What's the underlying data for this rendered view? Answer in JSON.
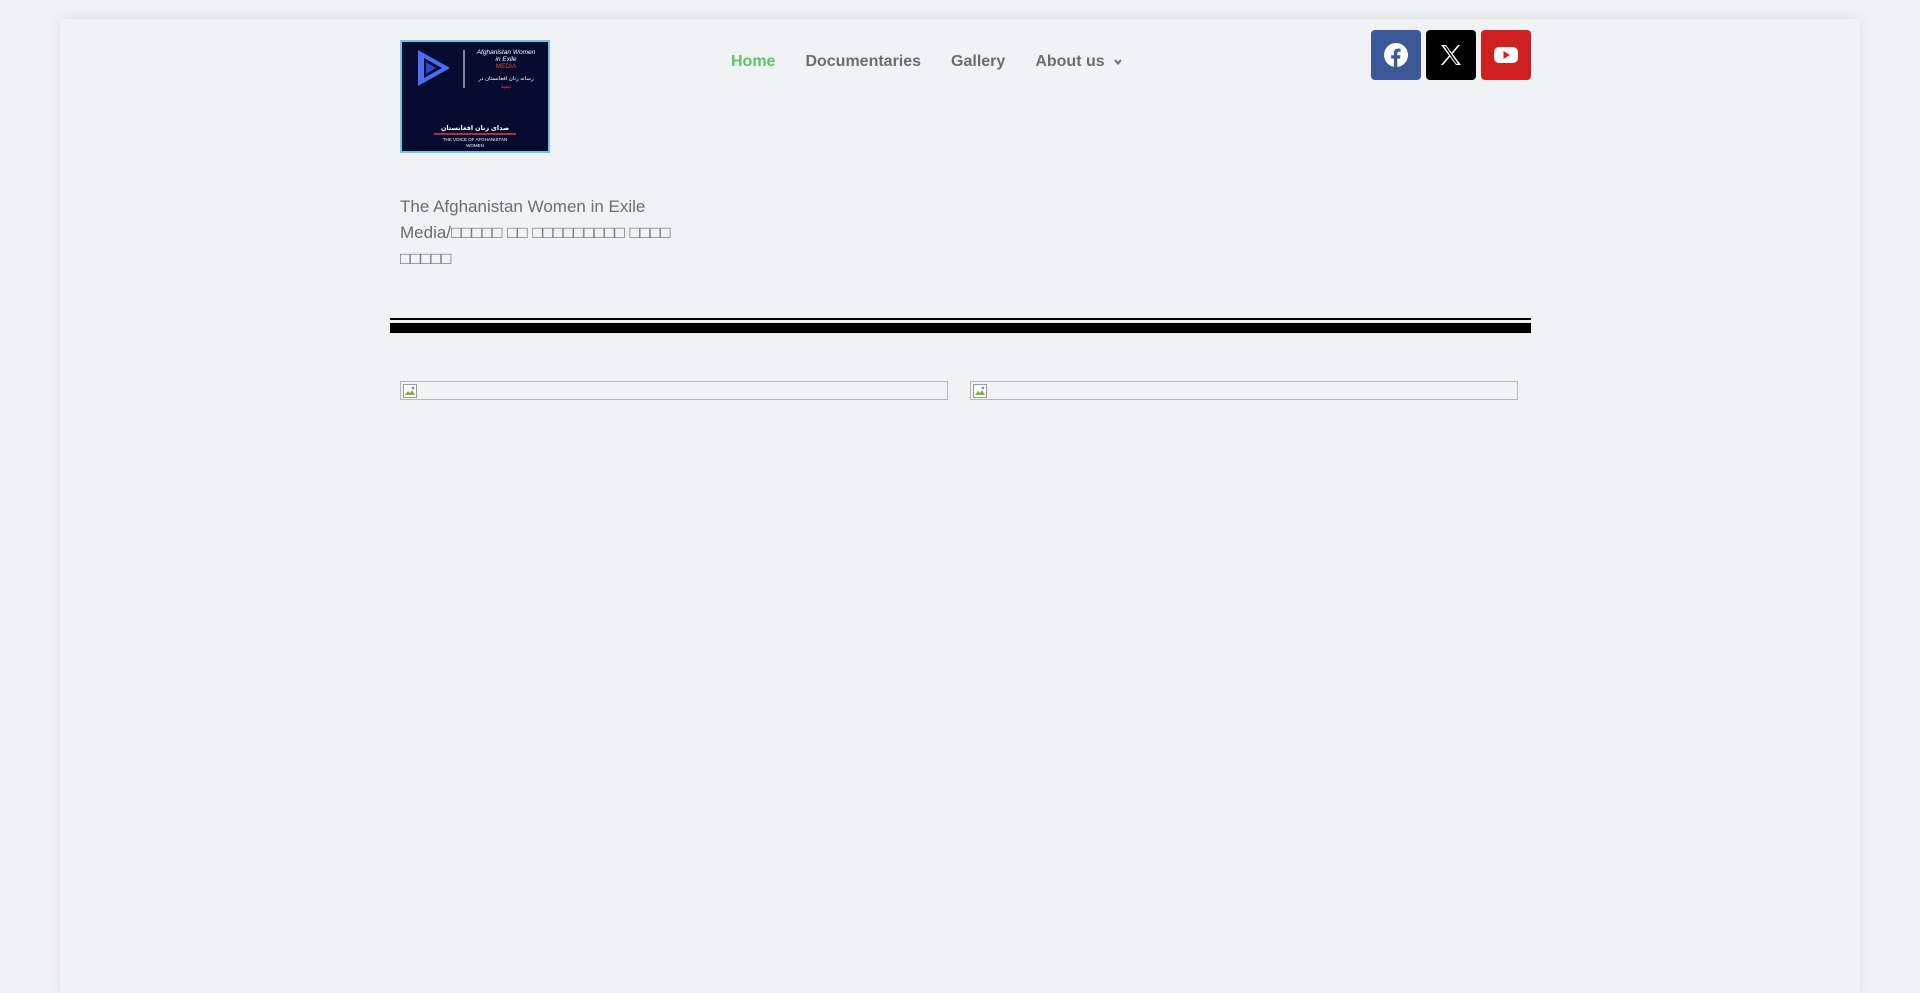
{
  "header": {
    "logo": {
      "title_line1": "Afghanistan Women",
      "title_line2": "in Exile",
      "title_line3": "MEDIA",
      "subtitle_fa": "رسانه زنان افغانستان در",
      "subtitle_fa2": "تبعید",
      "caption_fa": "صدای زنان افغانستان",
      "caption_en1": "THE VOICE OF AFGHANISTAN",
      "caption_en2": "WOMEN"
    },
    "nav": {
      "home": "Home",
      "documentaries": "Documentaries",
      "gallery": "Gallery",
      "about": "About us"
    },
    "social": [
      "facebook-icon",
      "x-icon",
      "youtube-icon"
    ]
  },
  "tagline": {
    "line1": "The Afghanistan Women in Exile",
    "line2": "Media/□□□□□ □□ □□□□□□□□□ □□□□ □□□□□"
  },
  "colors": {
    "active_nav": "#5fc36a",
    "nav_text": "#6a6d72",
    "facebook": "#3b5998",
    "x": "#000000",
    "youtube": "#cd201f"
  }
}
